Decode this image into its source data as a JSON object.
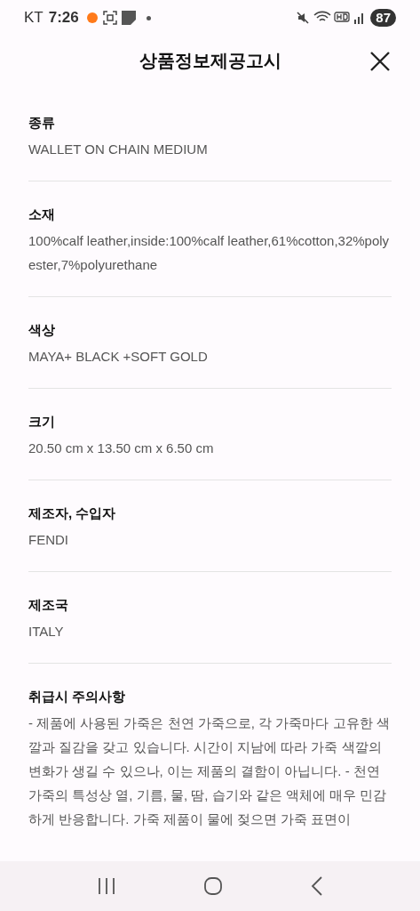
{
  "status_bar": {
    "carrier": "KT",
    "time": "7:26",
    "battery": "87"
  },
  "header": {
    "title": "상품정보제공고시"
  },
  "sections": [
    {
      "label": "종류",
      "value": "WALLET ON CHAIN MEDIUM"
    },
    {
      "label": "소재",
      "value": "100%calf leather,inside:100%calf leather,61%cotton,32%polyester,7%polyurethane"
    },
    {
      "label": "색상",
      "value": "MAYA+ BLACK +SOFT GOLD"
    },
    {
      "label": "크기",
      "value": "20.50 cm x 13.50 cm x 6.50 cm"
    },
    {
      "label": "제조자, 수입자",
      "value": "FENDI"
    },
    {
      "label": "제조국",
      "value": "ITALY"
    },
    {
      "label": "취급시 주의사항",
      "value": "- 제품에 사용된 가죽은 천연 가죽으로, 각 가죽마다 고유한 색깔과 질감을 갖고 있습니다. 시간이 지남에 따라 가죽 색깔의 변화가 생길 수 있으나, 이는 제품의 결함이 아닙니다. - 천연 가죽의 특성상 열, 기름, 물, 땀, 습기와 같은 액체에 매우 민감하게 반응합니다. 가죽 제품이 물에 젖으면 가죽 표면이"
    }
  ]
}
